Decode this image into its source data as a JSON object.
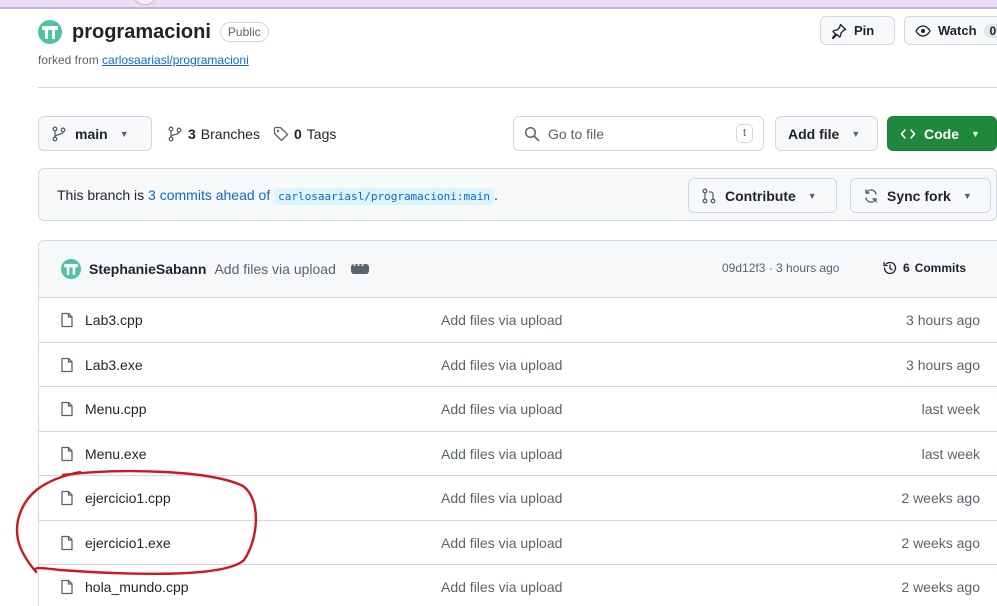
{
  "repo": {
    "name": "programacioni",
    "visibility": "Public",
    "forked_prefix": "forked from",
    "forked_link": "carlosaariasl/programacioni"
  },
  "header_actions": {
    "pin_label": "Pin",
    "watch_label": "Watch",
    "watch_count": "0"
  },
  "toolbar": {
    "branch_name": "main",
    "branches_count": "3",
    "branches_label": "Branches",
    "tags_count": "0",
    "tags_label": "Tags",
    "goto_placeholder": "Go to file",
    "goto_shortcut": "t",
    "add_file_label": "Add file",
    "code_label": "Code"
  },
  "fork_status": {
    "prefix": "This branch is",
    "commits_link": "3 commits ahead of",
    "upstream_ref": "carlosaariasl/programacioni:main",
    "suffix": ".",
    "contribute_label": "Contribute",
    "sync_fork_label": "Sync fork"
  },
  "latest_commit": {
    "author": "StephanieSabann",
    "message": "Add files via upload",
    "hash_time": "09d12f3 · 3 hours ago",
    "commits_count": "6",
    "commits_label": "Commits"
  },
  "files": [
    {
      "name": "Lab3.cpp",
      "message": "Add files via upload",
      "date": "3 hours ago"
    },
    {
      "name": "Lab3.exe",
      "message": "Add files via upload",
      "date": "3 hours ago"
    },
    {
      "name": "Menu.cpp",
      "message": "Add files via upload",
      "date": "last week"
    },
    {
      "name": "Menu.exe",
      "message": "Add files via upload",
      "date": "last week"
    },
    {
      "name": "ejercicio1.cpp",
      "message": "Add files via upload",
      "date": "2 weeks ago"
    },
    {
      "name": "ejercicio1.exe",
      "message": "Add files via upload",
      "date": "2 weeks ago"
    },
    {
      "name": "hola_mundo.cpp",
      "message": "Add files via upload",
      "date": "2 weeks ago"
    }
  ],
  "colors": {
    "accent": "#0969da",
    "code_button": "#1f883d",
    "annotation": "#d0161f",
    "avatar": "#4fc3a1"
  }
}
